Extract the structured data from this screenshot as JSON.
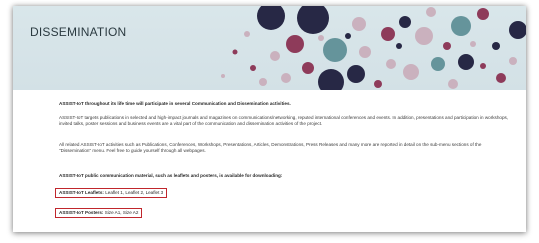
{
  "banner": {
    "title": "DISSEMINATION"
  },
  "content": {
    "intro": "ASSIST-IoT throughout its life time will participate in several Communication and Dissemination activities.",
    "targets": "ASSIST-IoT targets publications in selected and high-impact journals and magazines on communications/networking, reputed international conferences and events. In addition, presentations and participation in workshops, invited talks, poster sessions and business events are a vital part of the communication and dissemination activities of the project.",
    "related": "All related ASSIST-IoT activities such as Publications, Conferences, Workshops, Presentations, Articles, Demonstrations, Press Releases and many more are reported in detail on the sub-menu sections of the \"Dissemination\" menu. Feel free to guide yourself through all webpages.",
    "material_intro": "ASSIST-IoT public communication material, such as leaflets and posters, is available for downloading:",
    "leaflets": {
      "label": "ASSIST-IoT Leaflets:",
      "links": "Leaflet 1, Leaflet 2, Leaflet 3"
    },
    "posters": {
      "label": "ASSIST-IoT Posters:",
      "links": "Size A1, Size A2"
    }
  },
  "colors": {
    "banner_bg": "#d9e6ea",
    "circle_dark": "#1e1e3c",
    "circle_teal": "#5f8f97",
    "circle_plum": "#8a3152",
    "circle_pink": "#c8a8b6",
    "highlight_border": "#c0262c"
  }
}
